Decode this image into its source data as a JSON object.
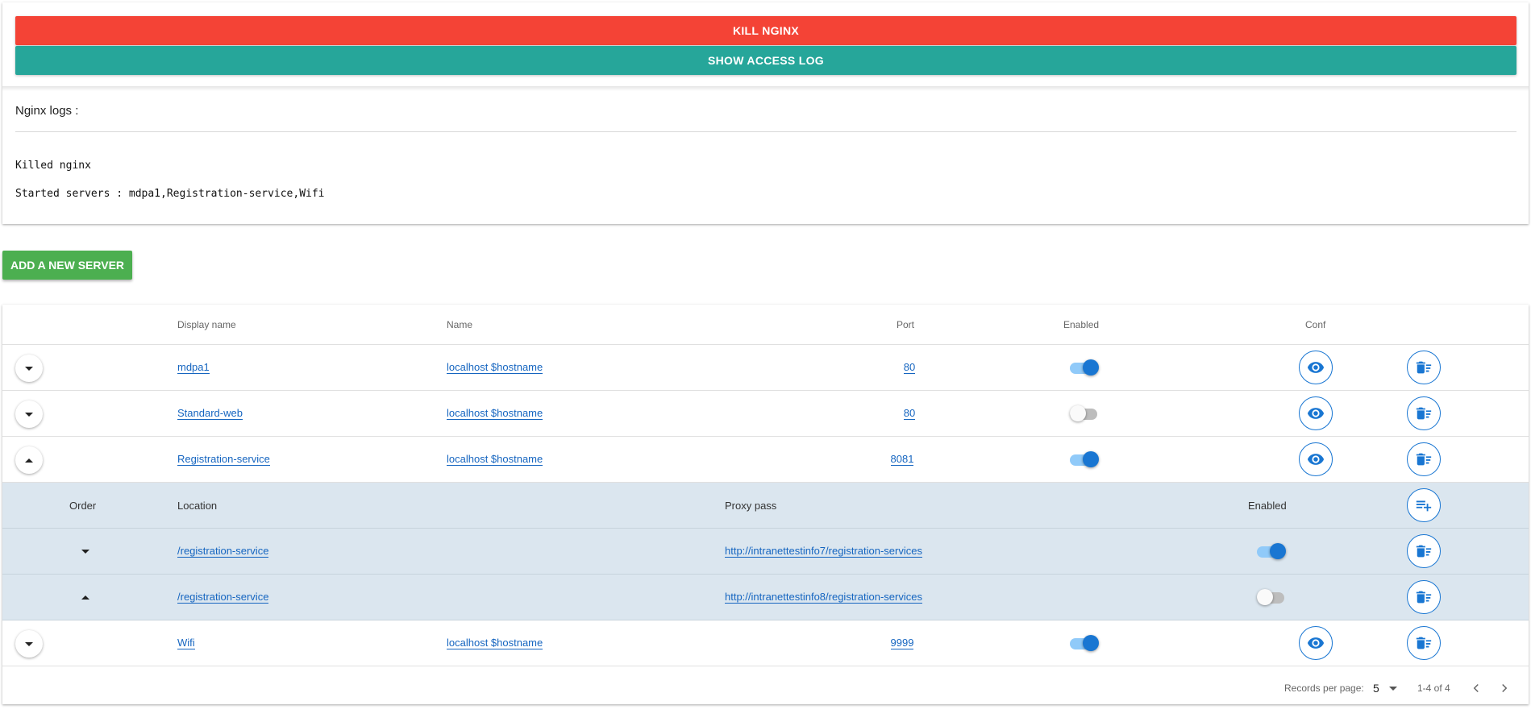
{
  "toolbar": {
    "kill_label": "KILL NGINX",
    "access_log_label": "SHOW ACCESS LOG"
  },
  "logs": {
    "title": "Nginx logs :",
    "lines": [
      "Killed nginx",
      "Started servers : mdpa1,Registration-service,Wifi"
    ]
  },
  "add_server_label": "ADD A NEW SERVER",
  "table": {
    "headers": {
      "display_name": "Display name",
      "name": "Name",
      "port": "Port",
      "enabled": "Enabled",
      "conf": "Conf"
    },
    "rows": [
      {
        "display_name": "mdpa1",
        "name": "localhost $hostname",
        "port": "80",
        "enabled": true,
        "expanded": false
      },
      {
        "display_name": "Standard-web",
        "name": "localhost $hostname",
        "port": "80",
        "enabled": false,
        "expanded": false
      },
      {
        "display_name": "Registration-service",
        "name": "localhost $hostname",
        "port": "8081",
        "enabled": true,
        "expanded": true
      },
      {
        "display_name": "Wifi",
        "name": "localhost $hostname",
        "port": "9999",
        "enabled": true,
        "expanded": false
      }
    ],
    "locations": {
      "headers": {
        "order": "Order",
        "location": "Location",
        "proxy_pass": "Proxy pass",
        "enabled": "Enabled"
      },
      "rows": [
        {
          "location": "/registration-service",
          "proxy_pass": "http://intranettestinfo7/registration-services",
          "enabled": true
        },
        {
          "location": "/registration-service",
          "proxy_pass": "http://intranettestinfo8/registration-services",
          "enabled": false
        }
      ]
    }
  },
  "pagination": {
    "records_label": "Records per page:",
    "per_page": "5",
    "range": "1-4 of 4"
  },
  "icons": {
    "view": "eye-icon",
    "delete": "delete-sweep-icon",
    "add_location": "playlist-add-icon",
    "expand": "caret-down-icon",
    "collapse": "caret-up-icon",
    "prev": "chevron-left-icon",
    "next": "chevron-right-icon"
  },
  "colors": {
    "danger": "#f44336",
    "teal": "#26a69a",
    "success": "#4caf50",
    "primary": "#1976d2",
    "sub_row_bg": "#dbe6ef"
  }
}
